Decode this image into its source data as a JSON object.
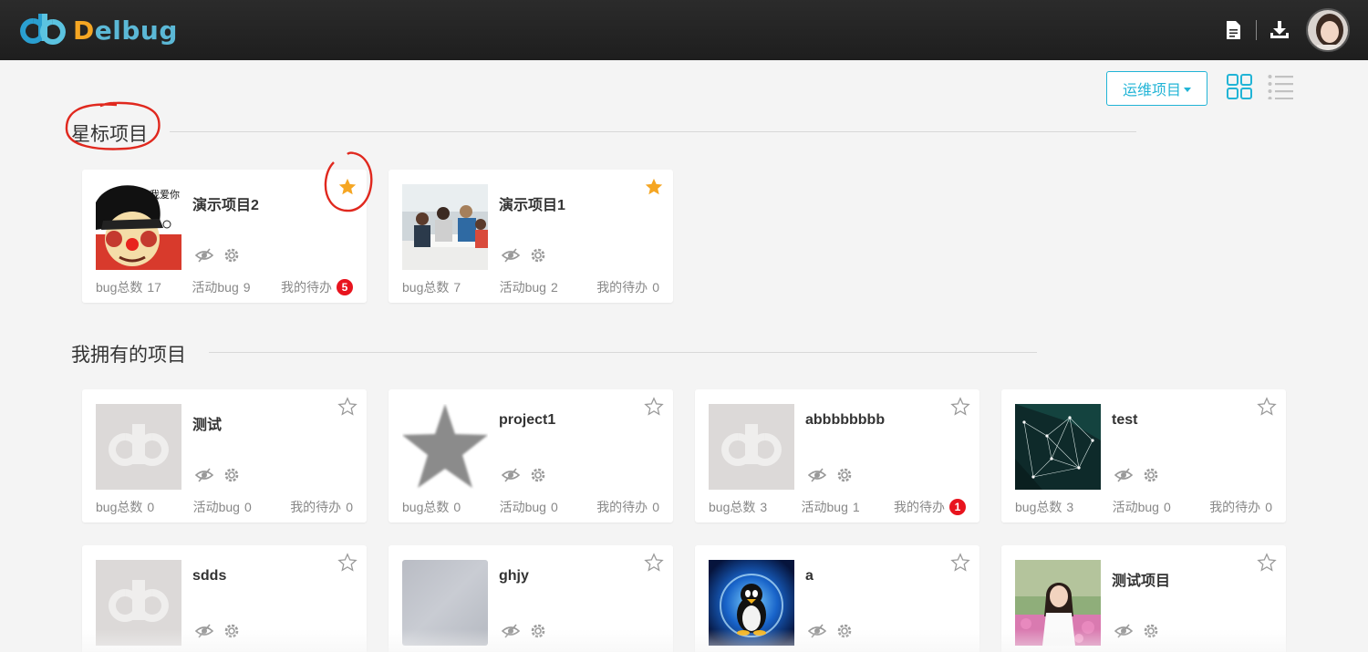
{
  "app": {
    "logo_d": "D",
    "logo_rest": "elbug"
  },
  "header": {
    "icons": [
      "document-icon",
      "download-icon"
    ]
  },
  "toolbar": {
    "filter_label": "运维项目",
    "views": [
      "grid-view-icon",
      "list-view-icon"
    ]
  },
  "sections": {
    "starred": {
      "title": "星标项目",
      "projects": [
        {
          "name": "演示项目2",
          "starred": true,
          "bug_total_label": "bug总数",
          "bug_total": "17",
          "active_bug_label": "活动bug",
          "active_bug": "9",
          "todo_label": "我的待办",
          "todo": "5",
          "todo_badge": true,
          "image": "cartoon-avatar",
          "image_text": "我爱你"
        },
        {
          "name": "演示项目1",
          "starred": true,
          "bug_total_label": "bug总数",
          "bug_total": "7",
          "active_bug_label": "活动bug",
          "active_bug": "2",
          "todo_label": "我的待办",
          "todo": "0",
          "todo_badge": false,
          "image": "office-photo"
        }
      ]
    },
    "owned": {
      "title": "我拥有的项目",
      "projects": [
        {
          "name": "测试",
          "starred": false,
          "bug_total_label": "bug总数",
          "bug_total": "0",
          "active_bug_label": "活动bug",
          "active_bug": "0",
          "todo_label": "我的待办",
          "todo": "0",
          "todo_badge": false,
          "image": "placeholder-logo"
        },
        {
          "name": "project1",
          "starred": false,
          "bug_total_label": "bug总数",
          "bug_total": "0",
          "active_bug_label": "活动bug",
          "active_bug": "0",
          "todo_label": "我的待办",
          "todo": "0",
          "todo_badge": false,
          "image": "grey-star"
        },
        {
          "name": "abbbbbbbb",
          "starred": false,
          "bug_total_label": "bug总数",
          "bug_total": "3",
          "active_bug_label": "活动bug",
          "active_bug": "1",
          "todo_label": "我的待办",
          "todo": "1",
          "todo_badge": true,
          "image": "placeholder-logo"
        },
        {
          "name": "test",
          "starred": false,
          "bug_total_label": "bug总数",
          "bug_total": "3",
          "active_bug_label": "活动bug",
          "active_bug": "0",
          "todo_label": "我的待办",
          "todo": "0",
          "todo_badge": false,
          "image": "network-dark"
        },
        {
          "name": "sdds",
          "starred": false,
          "image": "placeholder-logo"
        },
        {
          "name": "ghjy",
          "starred": false,
          "image": "grey-blur"
        },
        {
          "name": "a",
          "starred": false,
          "image": "penguin"
        },
        {
          "name": "测试项目",
          "starred": false,
          "image": "portrait-photo"
        }
      ]
    }
  },
  "colors": {
    "accent": "#21b4d6",
    "star_active": "#f5a623",
    "badge": "#e8141e",
    "annotation": "#e0281e"
  }
}
